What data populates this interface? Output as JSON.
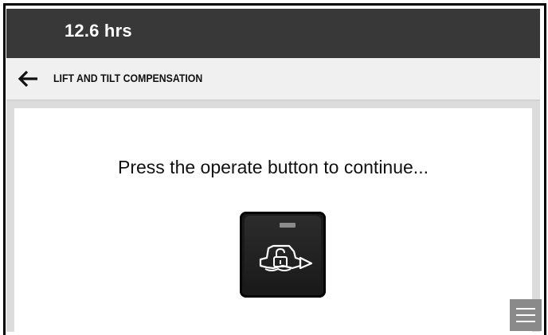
{
  "status_bar": {
    "hours": "12.6 hrs"
  },
  "nav": {
    "title": "LIFT AND TILT COMPENSATION",
    "back_icon": "arrow-left-icon"
  },
  "main": {
    "prompt": "Press the operate button to continue...",
    "operate_button_icon": "machine-unlock-icon"
  },
  "menu": {
    "icon": "hamburger-menu-icon"
  },
  "colors": {
    "status_bar_bg": "#383838",
    "nav_bg": "#f0f0f0",
    "content_bg": "#dcdcdc",
    "button_bg": "#1a1a1a",
    "menu_bg": "#8a8a8a"
  }
}
